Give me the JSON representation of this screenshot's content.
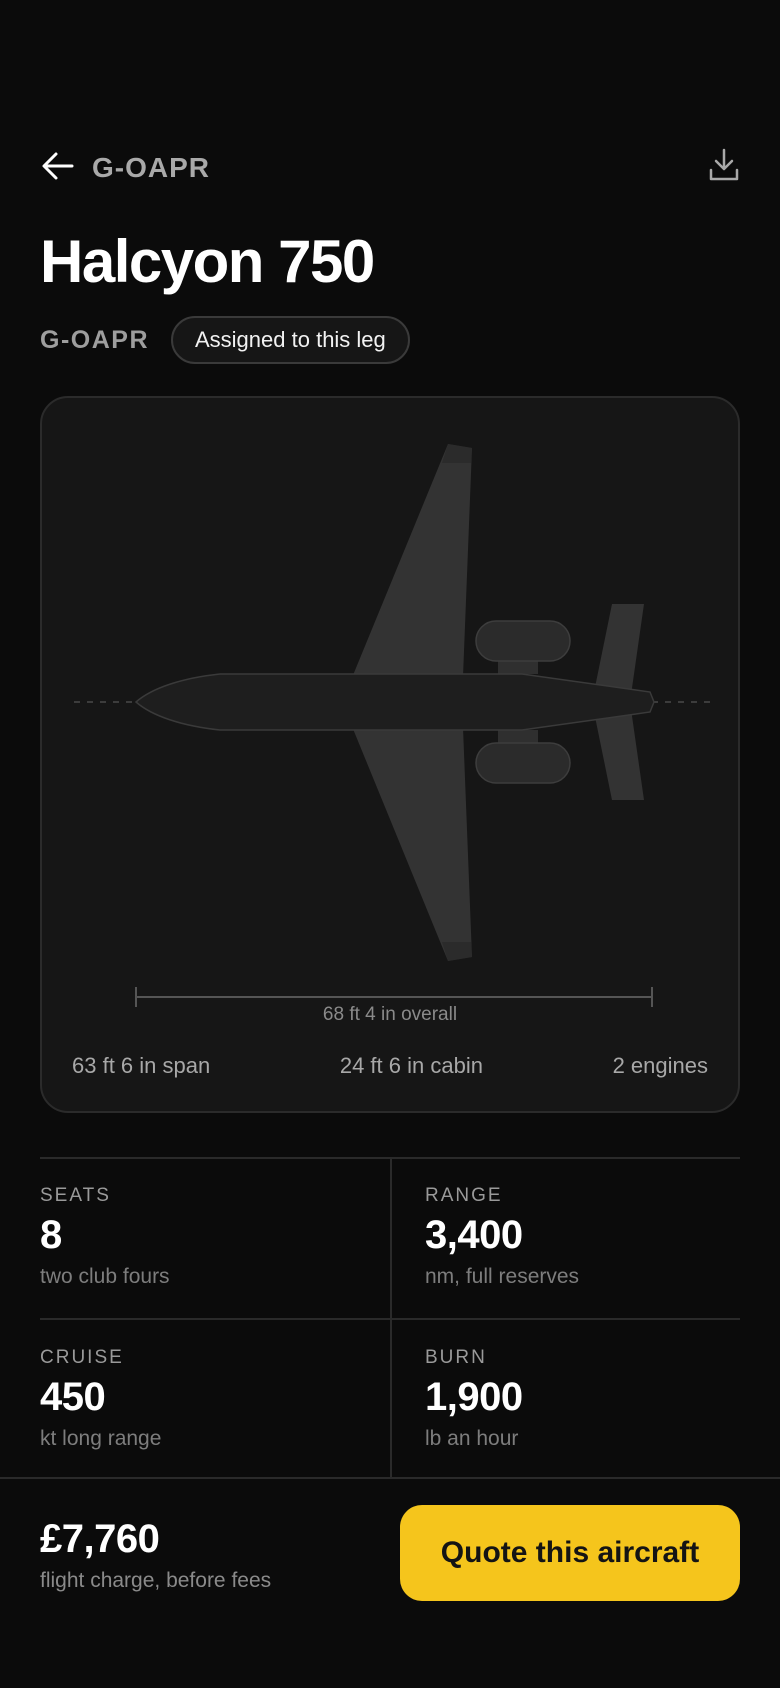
{
  "header": {
    "title": "G-OAPR",
    "back_icon": "arrow-left-icon",
    "download_icon": "download-icon"
  },
  "aircraft": {
    "name": "Halcyon 750",
    "registration": "G-OAPR",
    "badge": "Assigned to this leg"
  },
  "plan": {
    "overall": "68 ft 4 in overall",
    "span": "63 ft 6 in span",
    "cabin": "24 ft 6 in cabin",
    "engines": "2 engines"
  },
  "stats": [
    {
      "label": "SEATS",
      "value": "8",
      "sub": "two club fours"
    },
    {
      "label": "RANGE",
      "value": "3,400",
      "sub": "nm, full reserves"
    },
    {
      "label": "CRUISE",
      "value": "450",
      "sub": "kt long range"
    },
    {
      "label": "BURN",
      "value": "1,900",
      "sub": "lb an hour"
    }
  ],
  "footer": {
    "price": "£7,760",
    "price_sub": "flight charge, before fees",
    "cta": "Quote this aircraft"
  },
  "colors": {
    "background": "#0b0b0b",
    "card": "#161616",
    "accent": "#f5c51c"
  }
}
